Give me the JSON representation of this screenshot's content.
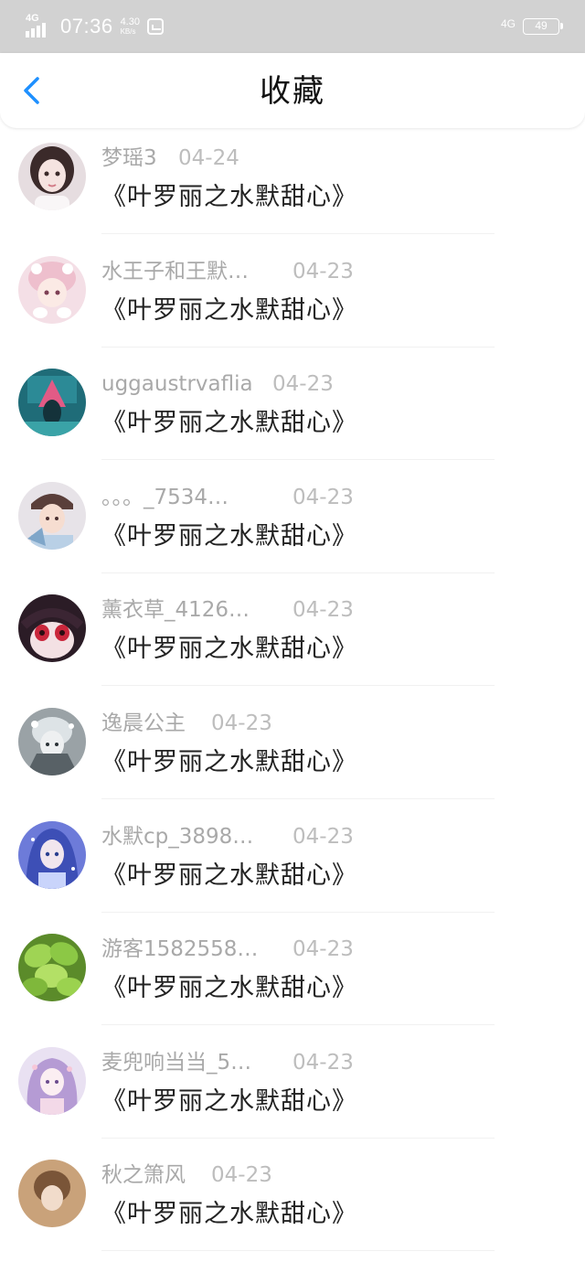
{
  "status_bar": {
    "network": "4G",
    "time": "07:36",
    "speed": "4.30",
    "speed_unit": "KB/s",
    "right_network": "4G",
    "battery": "49"
  },
  "nav": {
    "title": "收藏",
    "back_icon": "chevron-left-icon",
    "accent_color": "#1e90ff"
  },
  "favorites": [
    {
      "user": "梦瑶3",
      "date": "04-24",
      "book": "《叶罗丽之水默甜心》",
      "avatar": "avatar-1"
    },
    {
      "user": "水王子和王默…",
      "date": "04-23",
      "book": "《叶罗丽之水默甜心》",
      "avatar": "avatar-2"
    },
    {
      "user": "uggaustrvaflia",
      "date": "04-23",
      "book": "《叶罗丽之水默甜心》",
      "avatar": "avatar-3"
    },
    {
      "user": "。。。_7534…",
      "date": "04-23",
      "book": "《叶罗丽之水默甜心》",
      "avatar": "avatar-4"
    },
    {
      "user": "薰衣草_4126…",
      "date": "04-23",
      "book": "《叶罗丽之水默甜心》",
      "avatar": "avatar-5"
    },
    {
      "user": "逸晨公主",
      "date": "04-23",
      "book": "《叶罗丽之水默甜心》",
      "avatar": "avatar-6"
    },
    {
      "user": "水默cp_3898…",
      "date": "04-23",
      "book": "《叶罗丽之水默甜心》",
      "avatar": "avatar-7"
    },
    {
      "user": "游客1582558…",
      "date": "04-23",
      "book": "《叶罗丽之水默甜心》",
      "avatar": "avatar-8"
    },
    {
      "user": "麦兜响当当_5…",
      "date": "04-23",
      "book": "《叶罗丽之水默甜心》",
      "avatar": "avatar-9"
    },
    {
      "user": "秋之箫风",
      "date": "04-23",
      "book": "《叶罗丽之水默甜心》",
      "avatar": "avatar-10"
    }
  ]
}
